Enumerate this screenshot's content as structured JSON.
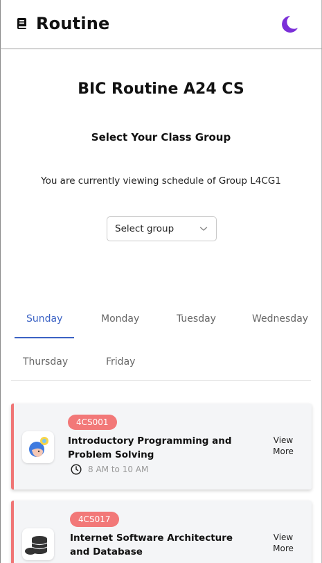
{
  "header": {
    "app_title": "Routine",
    "logo_icon": "book-icon",
    "theme_icon": "moon-icon",
    "theme_color": "#7b2fd8"
  },
  "intro": {
    "title": "BIC Routine A24 CS",
    "group_heading": "Select Your Class Group",
    "viewing_text": "You are currently viewing schedule of Group L4CG1",
    "select_placeholder": "Select group"
  },
  "tabs": [
    "Sunday",
    "Monday",
    "Tuesday",
    "Wednesday",
    "Thursday",
    "Friday"
  ],
  "active_tab": "Sunday",
  "accent_color": "#3b62c4",
  "classes": [
    {
      "code": "4CS001",
      "title": "Introductory Programming and Problem Solving",
      "time": "8 AM to 10 AM",
      "icon": "programmer-avatar-icon",
      "action": "View More"
    },
    {
      "code": "4CS017",
      "title": "Internet Software Architecture and Database",
      "time": "",
      "icon": "database-icon",
      "action": "View More"
    }
  ],
  "badge_color": "#f27878"
}
